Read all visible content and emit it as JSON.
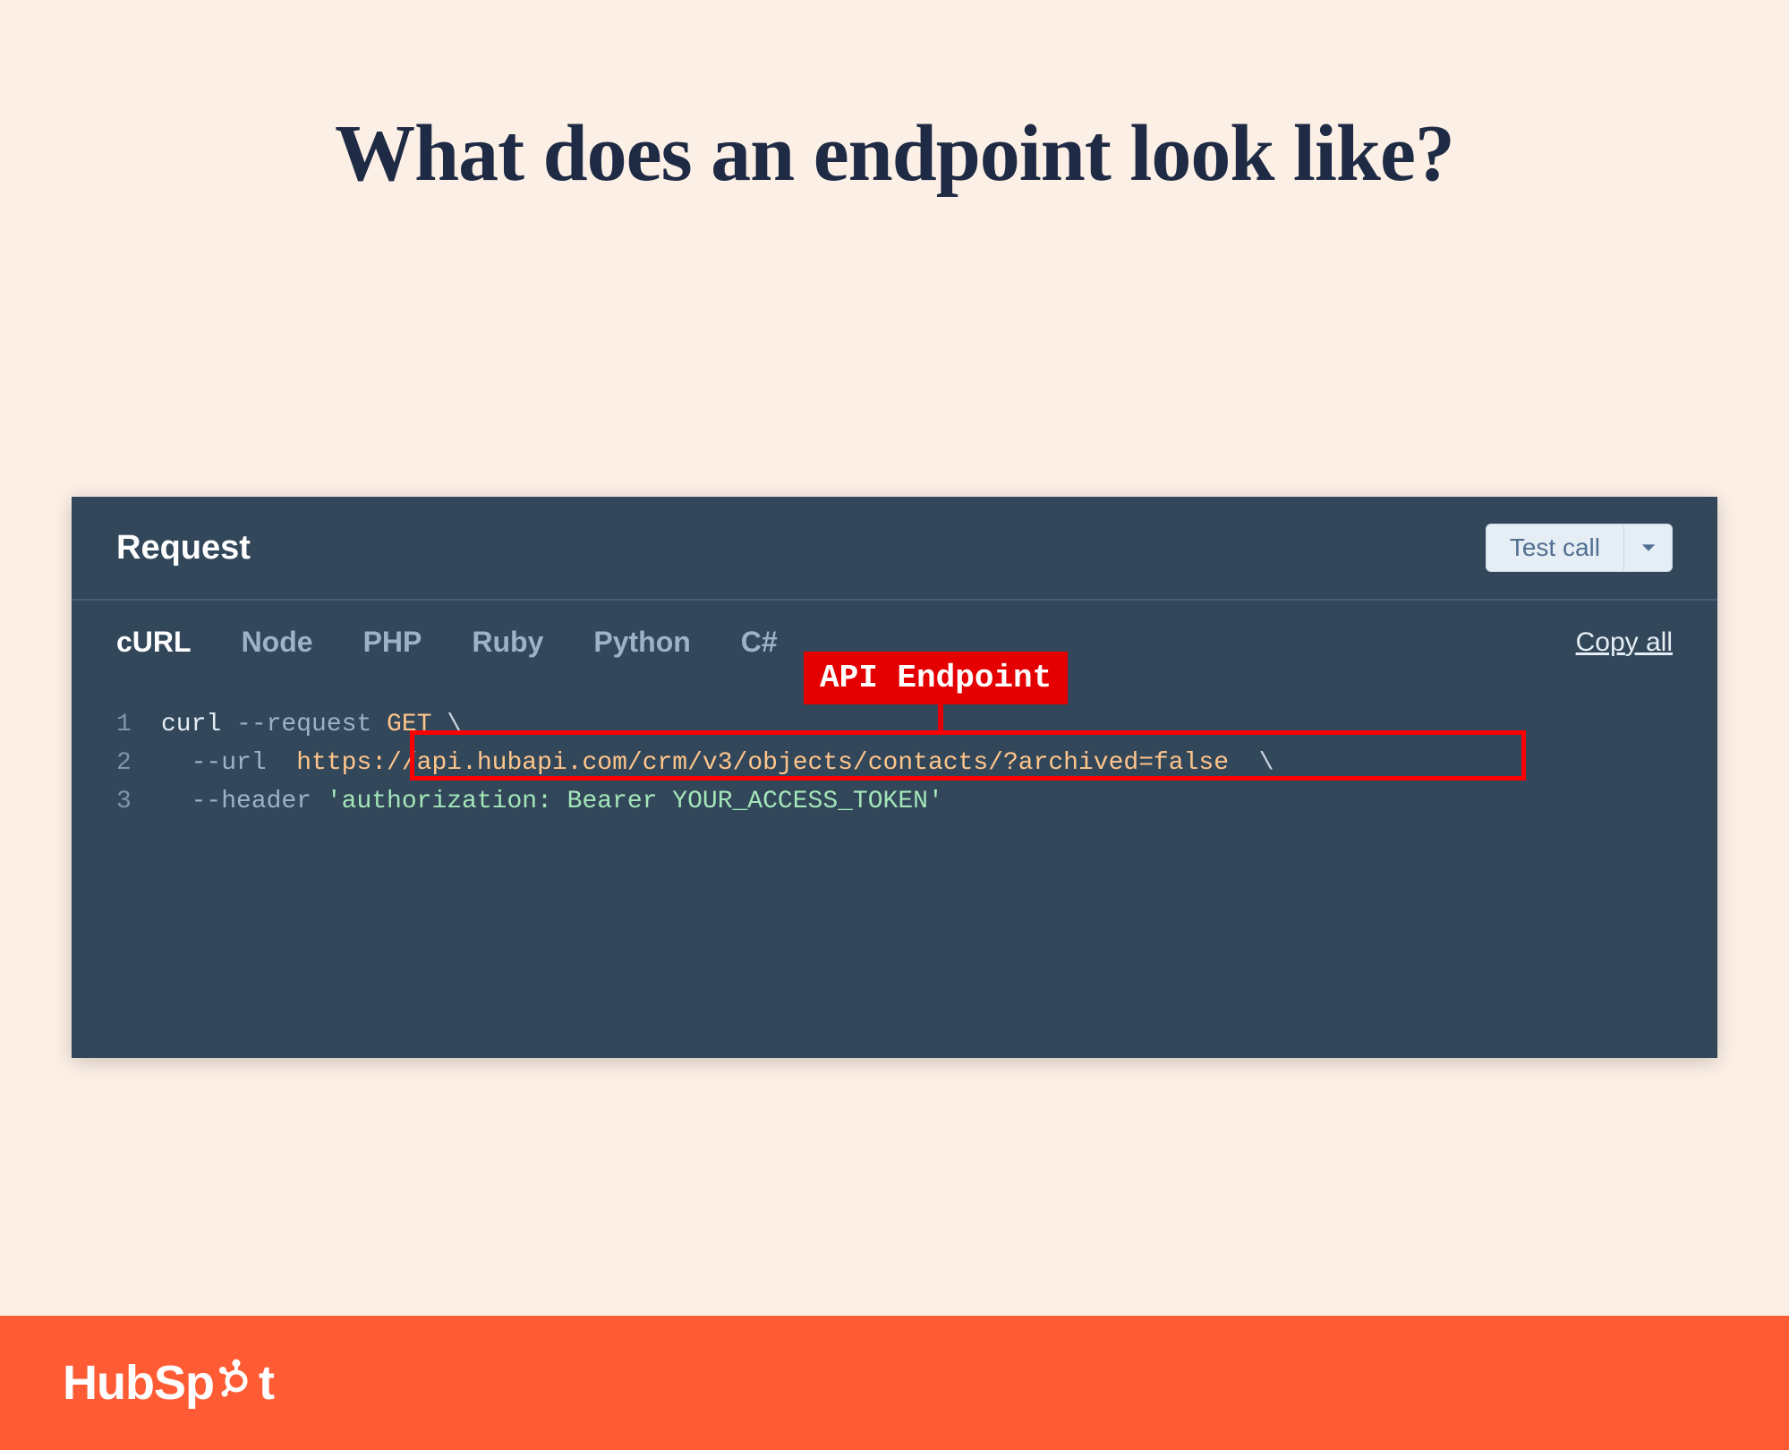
{
  "page": {
    "title": "What does an endpoint look like?"
  },
  "panel": {
    "header_title": "Request",
    "test_call_label": "Test call",
    "tabs": [
      "cURL",
      "Node",
      "PHP",
      "Ruby",
      "Python",
      "C#"
    ],
    "active_tab": "cURL",
    "copy_all_label": "Copy all",
    "code": {
      "line_numbers": [
        "1",
        "2",
        "3"
      ],
      "line1": {
        "cmd": "curl ",
        "flag": "--request",
        "method": " GET ",
        "bksl": "\\"
      },
      "line2": {
        "indent": "  ",
        "flag": "--url",
        "gap": "  ",
        "url": "https://api.hubapi.com/crm/v3/objects/contacts/?archived=false",
        "gap2": "  ",
        "bksl": "\\"
      },
      "line3": {
        "indent": "  ",
        "flag": "--header",
        "str": " 'authorization: Bearer YOUR_ACCESS_TOKEN'"
      }
    },
    "callout_label": "API Endpoint"
  },
  "footer": {
    "brand_hub": "Hub",
    "brand_spot": "Sp",
    "brand_ot": "t"
  }
}
